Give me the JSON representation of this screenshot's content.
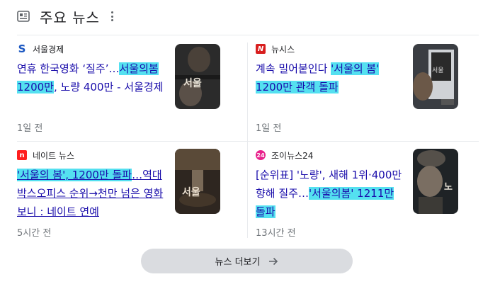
{
  "header": {
    "title": "주요 뉴스"
  },
  "cards": [
    {
      "source": "서울경제",
      "logo_char": "S",
      "logo_color": "#1c58c2",
      "headline_pre": "연휴 한국영화 ‘질주’…",
      "headline_hl": "서울의봄 1200만",
      "headline_post": ", 노량 400만 - 서울경제",
      "time": "1일 전"
    },
    {
      "source": "뉴시스",
      "logo_char": "N",
      "logo_color": "#d81e1e",
      "headline_pre": "계속 밀어붙인다 ",
      "headline_hl": "'서울의 봄' 1200만 관객 돌파",
      "headline_post": "",
      "time": "1일 전"
    },
    {
      "source": "네이트 뉴스",
      "logo_char": "n",
      "logo_color": "#ff1e1e",
      "headline_pre": "",
      "headline_hl": "'서울의 봄', 1200만 돌파",
      "headline_post": "…역대 박스오피스 순위→천만 넘은 영화 보니 : 네이트 연예",
      "time": "5시간 전"
    },
    {
      "source": "조이뉴스24",
      "logo_char": "24",
      "logo_color": "#e8228c",
      "headline_pre": "[순위표] '노량', 새해 1위·400만 향해 질주…",
      "headline_hl": "'서울의봄' 1211만 돌파",
      "headline_post": "",
      "time": "13시간 전"
    }
  ],
  "more_button": {
    "label": "뉴스 더보기"
  }
}
